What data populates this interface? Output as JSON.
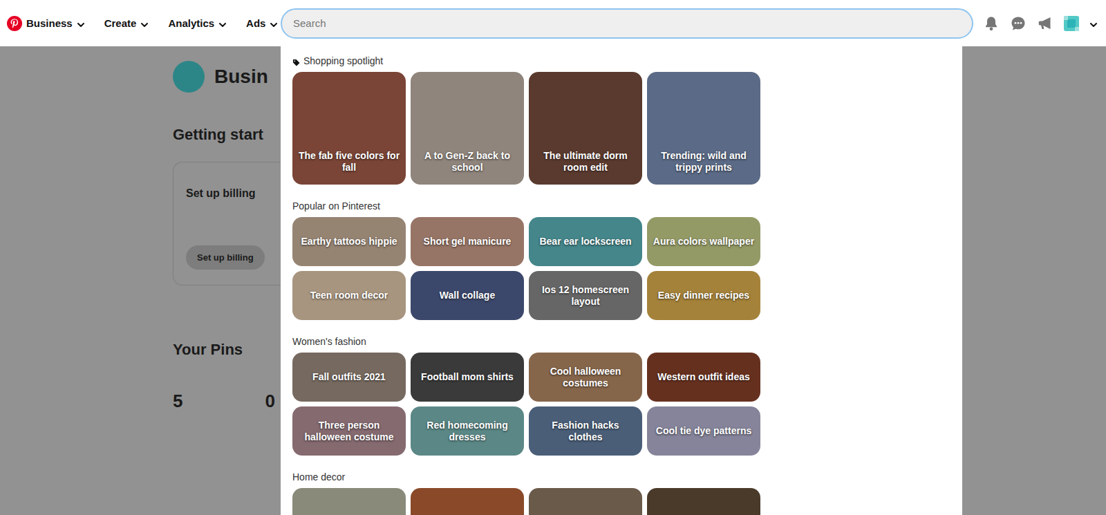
{
  "nav": {
    "brand": "Business",
    "menus": [
      "Create",
      "Analytics",
      "Ads"
    ]
  },
  "search": {
    "placeholder": "Search"
  },
  "background": {
    "title": "Busin",
    "getting_started": "Getting start",
    "card_title": "Set up billing",
    "card_button": "Set up billing",
    "pins_title": "Your Pins",
    "stats": [
      "5",
      "0"
    ]
  },
  "sections": [
    {
      "title": "Shopping spotlight",
      "kind": "spotlight",
      "tiles": [
        {
          "label": "The fab five colors for fall",
          "color": "#7a4536"
        },
        {
          "label": "A to Gen-Z back to school",
          "color": "#8f857c"
        },
        {
          "label": "The ultimate dorm room edit",
          "color": "#5a3a2e"
        },
        {
          "label": "Trending: wild and trippy prints",
          "color": "#5b6a86"
        }
      ]
    },
    {
      "title": "Popular on Pinterest",
      "kind": "small",
      "tiles": [
        {
          "label": "Earthy tattoos hippie",
          "color": "#968473"
        },
        {
          "label": "Short gel manicure",
          "color": "#977566"
        },
        {
          "label": "Bear ear lockscreen",
          "color": "#44868a"
        },
        {
          "label": "Aura colors wallpaper",
          "color": "#949a66"
        },
        {
          "label": "Teen room decor",
          "color": "#a8957f"
        },
        {
          "label": "Wall collage",
          "color": "#3c486b"
        },
        {
          "label": "Ios 12 homescreen layout",
          "color": "#666666"
        },
        {
          "label": "Easy dinner recipes",
          "color": "#a5823a"
        }
      ]
    },
    {
      "title": "Women's fashion",
      "kind": "small",
      "tiles": [
        {
          "label": "Fall outfits 2021",
          "color": "#76695f"
        },
        {
          "label": "Football mom shirts",
          "color": "#3a3a3a"
        },
        {
          "label": "Cool halloween costumes",
          "color": "#86664b"
        },
        {
          "label": "Western outfit ideas",
          "color": "#66301f"
        },
        {
          "label": "Three person halloween costume",
          "color": "#856a70"
        },
        {
          "label": "Red homecoming dresses",
          "color": "#5b8886"
        },
        {
          "label": "Fashion hacks clothes",
          "color": "#4a5e78"
        },
        {
          "label": "Cool tie dye patterns",
          "color": "#85849a"
        }
      ]
    },
    {
      "title": "Home decor",
      "kind": "small",
      "tiles": [
        {
          "color": "#8a8a7a"
        },
        {
          "color": "#8a4a2a"
        },
        {
          "color": "#6a5a4a"
        },
        {
          "color": "#4a3a2a"
        }
      ]
    }
  ]
}
